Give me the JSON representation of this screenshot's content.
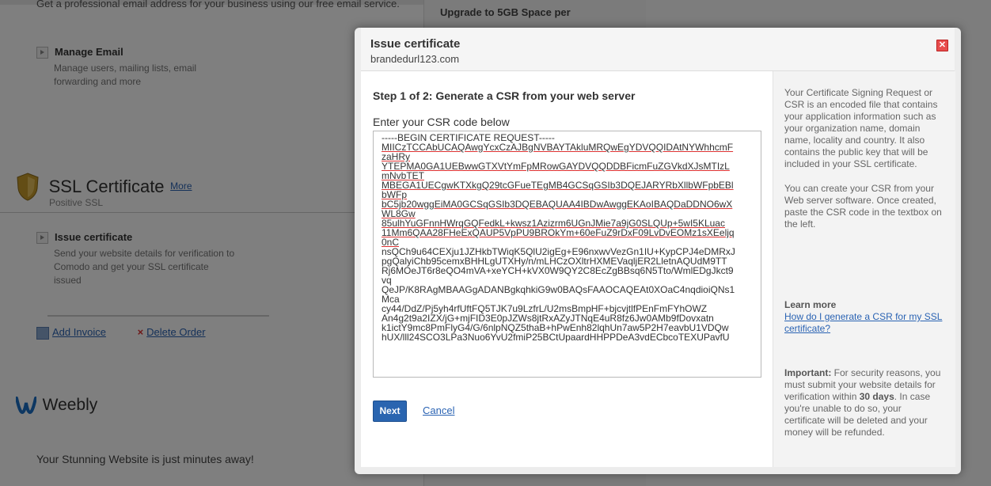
{
  "background": {
    "top_description": "Get a professional email address for your business using our free email service.",
    "upgrade_text": "Upgrade to 5GB Space per",
    "manage_email": {
      "title": "Manage Email",
      "description": "Manage users, mailing lists, email forwarding and more"
    },
    "ssl": {
      "title": "SSL Certificate",
      "more": "More",
      "subtitle": "Positive SSL"
    },
    "issue_certificate": {
      "title": "Issue certificate",
      "description": "Send your website details for verification to Comodo and get your SSL certificate issued"
    },
    "add_invoice": "Add Invoice",
    "delete_order": "Delete Order",
    "weebly": "Weebly",
    "stunning": "Your Stunning Website is just minutes away!"
  },
  "modal": {
    "title": "Issue certificate",
    "subtitle": "brandedurl123.com",
    "close_glyph": "✕",
    "step_title": "Step 1 of 2: Generate a CSR from your web server",
    "csr_label": "Enter your CSR code below",
    "csr_lines": [
      {
        "text": "-----BEGIN CERTIFICATE REQUEST-----",
        "err": false
      },
      {
        "text": "MIICzTCCAbUCAQAwgYcxCzAJBgNVBAYTAkluMRQwEgYDVQQIDAtNYWhhcmF",
        "err": true
      },
      {
        "text": "zaHRy",
        "err": true
      },
      {
        "text": "YTEPMA0GA1UEBwwGTXVtYmFpMRowGAYDVQQDDBFicmFuZGVkdXJsMTIzL",
        "err": true
      },
      {
        "text": "mNvbTET",
        "err": true
      },
      {
        "text": "MBEGA1UECgwKTXkgQ29tcGFueTEgMB4GCSqGSIb3DQEJARYRbXllbWFpbEBl",
        "err": true
      },
      {
        "text": "bWFp",
        "err": true
      },
      {
        "text": "bC5jb20wggEiMA0GCSqGSIb3DQEBAQUAA4IBDwAwggEKAoIBAQDaDDNO6wX",
        "err": true
      },
      {
        "text": "WL8Gw",
        "err": true
      },
      {
        "text": "85ulhYuGFnnHWrqGQFedkL+kwsz1Azizrm6UGnJMie7a9jG0SLQUp+5wI5KLuac",
        "err": true
      },
      {
        "text": "11Mm6QAA28FHeExQAUP5VpPU9BROkYm+60eFuZ9rDxF09LvDvEOMz1sXEeljq",
        "err": true
      },
      {
        "text": "0nC",
        "err": true
      },
      {
        "text": "nsQCh9u64CEXju1JZHkbTWiqK5QlU2igEg+E96nxwvVezGn1IU+KypCPJ4eDMRxJ",
        "err": false
      },
      {
        "text": "pgQalyiChb95cemxBHHLgUTXHy/n/mLHCzOXltrHXMEVaqljER2LletnAQUdM9TT",
        "err": false
      },
      {
        "text": "Rj6MOeJT6r8eQO4mVA+xeYCH+kVX0W9QY2C8EcZgBBsq6N5Tto/WmlEDgJkct9",
        "err": false
      },
      {
        "text": "vq",
        "err": false
      },
      {
        "text": "QeJP/K8RAgMBAAGgADANBgkqhkiG9w0BAQsFAAOCAQEAt0XOaC4nqdioiQNs1",
        "err": false
      },
      {
        "text": "Mca",
        "err": false
      },
      {
        "text": "cy44/DdZ/Pj5yh4rfUftFQ5TJK7u9LzfrL/U2msBmpHF+bjcvjtlfPEnFmFYhOWZ",
        "err": false
      },
      {
        "text": "An4g2t9a2IZX/jG+mjFID3E0pJZWs8jtRxAZyJTNqE4uR8fz6Jw0AMb9fDovxatn",
        "err": false
      },
      {
        "text": "k1ictY9mc8PmFlyG4/G/6nlpNQZ5thaB+hPwEnh82lqhUn7aw5P2H7eavbU1VDQw",
        "err": false
      },
      {
        "text": "hUX/lll24SCO3LPa3Nuo6YvU2fmiP25BCtUpaardHHPPDeA3vdECbcoTEXUPavfU",
        "err": false
      }
    ],
    "next_label": "Next",
    "cancel_label": "Cancel",
    "side_p1": "Your Certificate Signing Request or CSR is an encoded file that contains your application information such as your organization name, domain name, locality and country. It also contains the public key that will be included in your SSL certificate.",
    "side_p2": "You can create your CSR from your Web server software. Once created, paste the CSR code in the textbox on the left.",
    "learn_more": "Learn more",
    "how_link": "How do I generate a CSR for my SSL certificate?",
    "important_label": "Important:",
    "important_text_a": " For security reasons, you must submit your website details for verification within ",
    "important_days": "30 days",
    "important_text_b": ". In case you're unable to do so, your certificate will be deleted and your money will be refunded."
  },
  "colors": {
    "accent_blue": "#2a65b0",
    "link_blue": "#2a63b3",
    "close_red": "#e84d4d"
  },
  "icons": {
    "close": "close-icon",
    "ssl_shield": "shield-icon",
    "weebly_logo": "weebly-logo-icon",
    "add_invoice": "invoice-icon",
    "delete": "delete-x-icon"
  }
}
